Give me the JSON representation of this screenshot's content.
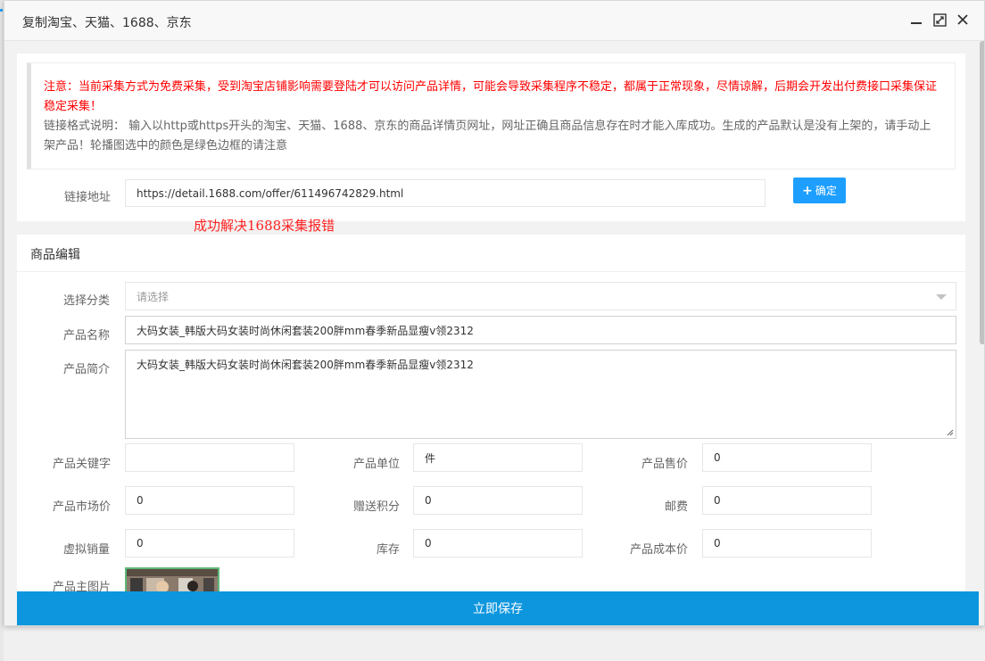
{
  "window": {
    "title": "复制淘宝、天猫、1688、京东"
  },
  "notice": {
    "warning": "注意：当前采集方式为免费采集，受到淘宝店铺影响需要登陆才可以访问产品详情，可能会导致采集程序不稳定，都属于正常现象，尽情谅解，后期会开发出付费接口采集保证稳定采集！",
    "description": "链接格式说明： 输入以http或https开头的淘宝、天猫、1688、京东的商品详情页网址，网址正确且商品信息存在时才能入库成功。生成的产品默认是没有上架的，请手动上架产品！轮播图选中的颜色是绿色边框的请注意"
  },
  "link": {
    "label": "链接地址",
    "value": "https://detail.1688.com/offer/611496742829.html",
    "button_label": "确定"
  },
  "red_note": "成功解决1688采集报错",
  "editor": {
    "header": "商品编辑",
    "category": {
      "label": "选择分类",
      "placeholder": "请选择"
    },
    "name": {
      "label": "产品名称",
      "value": "大码女装_韩版大码女装时尚休闲套装200胖mm春季新品显瘦v领2312"
    },
    "intro": {
      "label": "产品简介",
      "value": "大码女装_韩版大码女装时尚休闲套装200胖mm春季新品显瘦v领2312"
    },
    "keywords": {
      "label": "产品关键字",
      "value": ""
    },
    "unit": {
      "label": "产品单位",
      "value": "件"
    },
    "price": {
      "label": "产品售价",
      "value": "0"
    },
    "market_price": {
      "label": "产品市场价",
      "value": "0"
    },
    "points": {
      "label": "赠送积分",
      "value": "0"
    },
    "postage": {
      "label": "邮费",
      "value": "0"
    },
    "virtual_sales": {
      "label": "虚拟销量",
      "value": "0"
    },
    "stock": {
      "label": "库存",
      "value": "0"
    },
    "cost": {
      "label": "产品成本价",
      "value": "0"
    },
    "main_image": {
      "label": "产品主图片"
    }
  },
  "save_button": "立即保存",
  "colors": {
    "primary": "#1e9fff",
    "save_bar": "#0d96de",
    "warning_text": "#ff0000",
    "selected_border": "#5fb878"
  }
}
